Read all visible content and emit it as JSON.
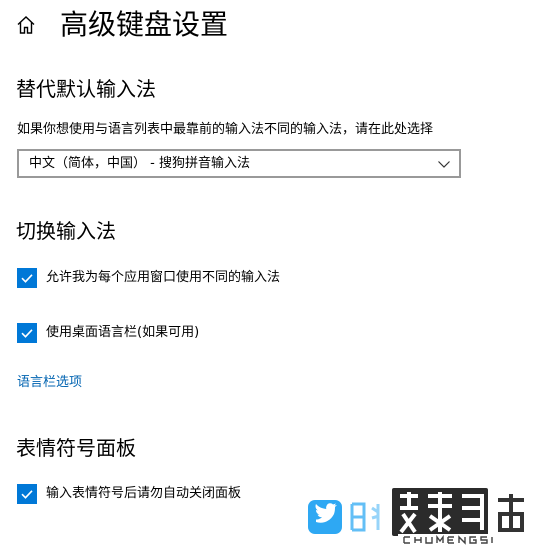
{
  "header": {
    "title": "高级键盘设置",
    "home_icon": "home-icon"
  },
  "override_input": {
    "title": "替代默认输入法",
    "description": "如果你想使用与语言列表中最靠前的输入法不同的输入法，请在此处选择",
    "dropdown_value": "中文（简体，中国） - 搜狗拼音输入法"
  },
  "switch_input": {
    "title": "切换输入法",
    "options": [
      {
        "label": "允许我为每个应用窗口使用不同的输入法",
        "checked": true
      },
      {
        "label": "使用桌面语言栏(如果可用)",
        "checked": true
      }
    ],
    "link": "语言栏选项"
  },
  "emoji_panel": {
    "title": "表情符号面板",
    "options": [
      {
        "label": "输入表情符号后请勿自动关闭面板",
        "checked": true
      }
    ]
  },
  "colors": {
    "accent": "#0078d7",
    "link": "#0063b1"
  }
}
